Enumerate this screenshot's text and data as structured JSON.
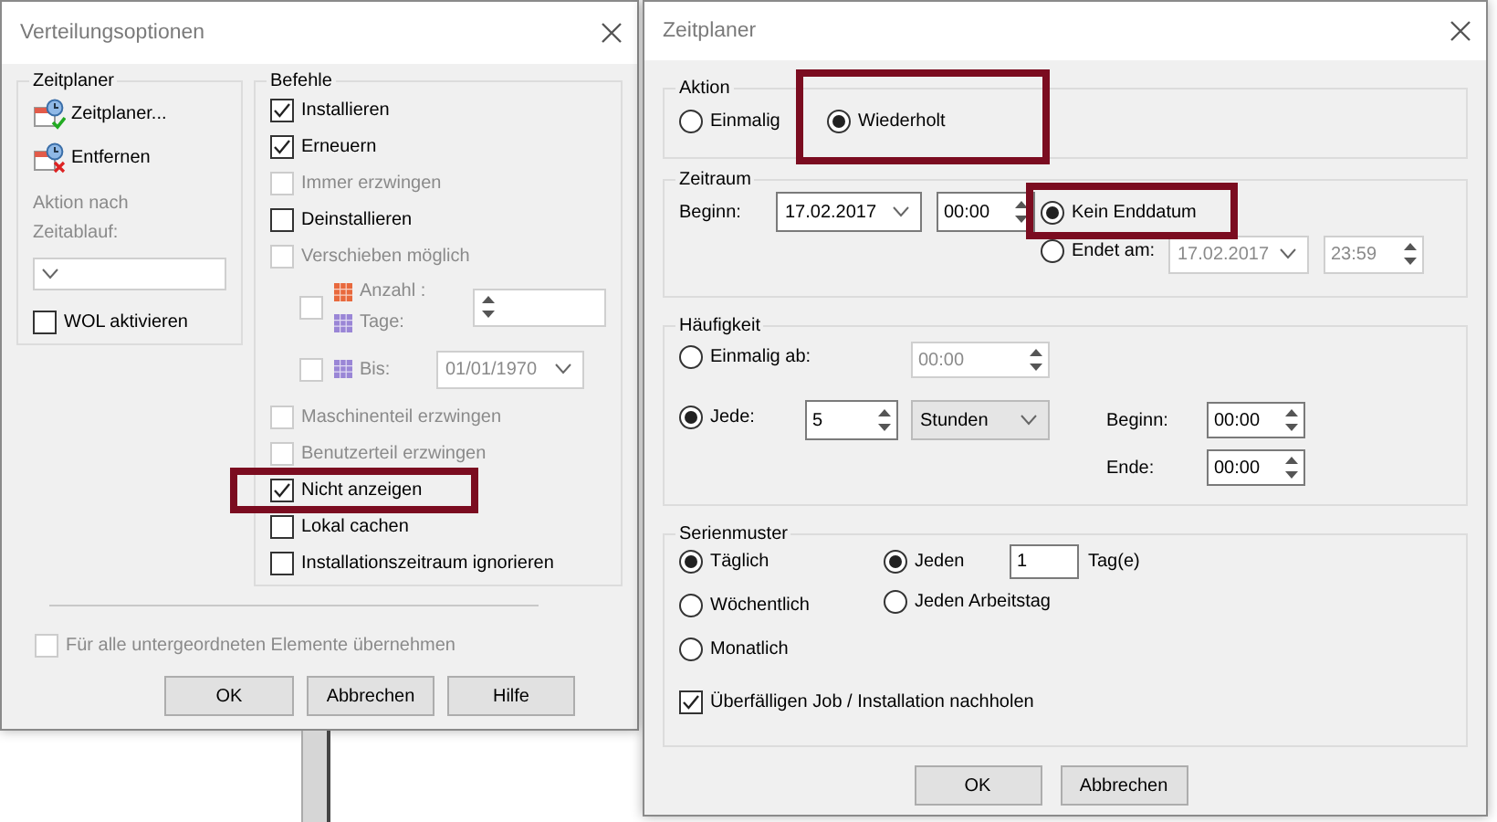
{
  "distribution_dialog": {
    "title": "Verteilungsoptionen",
    "scheduler": {
      "title": "Zeitplaner",
      "actions": [
        {
          "label": "Zeitplaner...",
          "kind": "schedule"
        },
        {
          "label": "Entfernen",
          "kind": "remove"
        }
      ],
      "after_timeout": {
        "label": "Aktion nach Zeitablauf:",
        "disabled": true
      },
      "wol": {
        "label": "WOL aktivieren",
        "checked": false
      }
    },
    "commands": {
      "title": "Befehle",
      "items": [
        {
          "kind": "check",
          "label": "Installieren",
          "checked": true,
          "disabled": false
        },
        {
          "kind": "check",
          "label": "Erneuern",
          "checked": true,
          "disabled": false
        },
        {
          "kind": "check",
          "label": "Immer erzwingen",
          "checked": false,
          "disabled": true
        },
        {
          "kind": "check",
          "label": "Deinstallieren",
          "checked": false,
          "disabled": false
        },
        {
          "kind": "check",
          "label": "Verschieben möglich",
          "checked": false,
          "disabled": true
        },
        {
          "kind": "count",
          "labels": [
            "Anzahl :",
            "Tage:"
          ],
          "checked": false,
          "disabled": true
        },
        {
          "kind": "until",
          "label": "Bis:",
          "value": "01/01/1970",
          "checked": false,
          "disabled": true
        },
        {
          "kind": "check",
          "label": "Maschinenteil erzwingen",
          "checked": false,
          "disabled": true
        },
        {
          "kind": "check",
          "label": "Benutzerteil erzwingen",
          "checked": false,
          "disabled": true
        },
        {
          "kind": "check",
          "label": "Nicht anzeigen",
          "checked": true,
          "disabled": false
        },
        {
          "kind": "check",
          "label": "Lokal cachen",
          "checked": false,
          "disabled": false
        },
        {
          "kind": "check",
          "label": "Installationszeitraum ignorieren",
          "checked": false,
          "disabled": false
        }
      ]
    },
    "apply_all": {
      "label": "Für alle untergeordneten Elemente übernehmen",
      "checked": false,
      "disabled": true
    },
    "buttons": [
      "OK",
      "Abbrechen",
      "Hilfe"
    ]
  },
  "scheduler_dialog": {
    "title": "Zeitplaner",
    "action": {
      "title": "Aktion",
      "options": [
        {
          "label": "Einmalig",
          "selected": false
        },
        {
          "label": "Wiederholt",
          "selected": true
        }
      ]
    },
    "period": {
      "title": "Zeitraum",
      "start_label": "Beginn:",
      "start_date": "17.02.2017",
      "start_time": "00:00",
      "end_options": [
        {
          "label": "Kein Enddatum",
          "selected": true
        },
        {
          "label": "Endet am:",
          "selected": false,
          "date": "17.02.2017",
          "time": "23:59"
        }
      ]
    },
    "frequency": {
      "title": "Häufigkeit",
      "once": {
        "label": "Einmalig ab:",
        "selected": false,
        "time": "00:00"
      },
      "every": {
        "label": "Jede:",
        "selected": true,
        "value": "5",
        "unit": "Stunden"
      },
      "start": {
        "label": "Beginn:",
        "time": "00:00"
      },
      "end": {
        "label": "Ende:",
        "time": "00:00"
      }
    },
    "pattern": {
      "title": "Serienmuster",
      "types": [
        {
          "label": "Täglich",
          "selected": true
        },
        {
          "label": "Wöchentlich",
          "selected": false
        },
        {
          "label": "Monatlich",
          "selected": false
        }
      ],
      "daily_options": [
        {
          "label": "Jeden",
          "selected": true,
          "value": "1",
          "suffix": "Tag(e)"
        },
        {
          "label": "Jeden Arbeitstag",
          "selected": false
        }
      ],
      "catch_up": {
        "label": "Überfälligen Job / Installation nachholen",
        "checked": true
      }
    },
    "buttons": [
      "OK",
      "Abbrechen"
    ]
  }
}
